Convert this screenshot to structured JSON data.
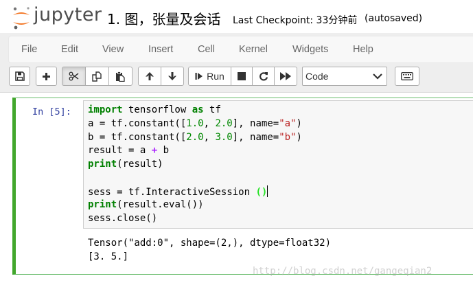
{
  "header": {
    "logo_text": "jupyter",
    "notebook_title": "1. 图，张量及会话",
    "checkpoint": "Last Checkpoint: 33分钟前",
    "autosave_status": "(autosaved)"
  },
  "menu": {
    "items": [
      "File",
      "Edit",
      "View",
      "Insert",
      "Cell",
      "Kernel",
      "Widgets",
      "Help"
    ]
  },
  "toolbar": {
    "run_label": "Run",
    "cell_type": "Code",
    "icons": [
      "save-icon",
      "plus-icon",
      "scissors-icon",
      "copy-icon",
      "paste-icon",
      "arrow-up-icon",
      "arrow-down-icon",
      "step-forward-icon",
      "stop-icon",
      "restart-icon",
      "fast-forward-icon",
      "keyboard-icon"
    ]
  },
  "cell": {
    "prompt": "In [5]:",
    "code": {
      "l1": {
        "kw": "import",
        "a": " tensorflow ",
        "kw2": "as",
        "b": " tf"
      },
      "l2": {
        "a": "a = tf.constant([",
        "n1": "1.0",
        "c": ", ",
        "n2": "2.0",
        "d": "], name=",
        "s": "\"a\"",
        "e": ")"
      },
      "l3": {
        "a": "b = tf.constant([",
        "n1": "2.0",
        "c": ", ",
        "n2": "3.0",
        "d": "], name=",
        "s": "\"b\"",
        "e": ")"
      },
      "l4": {
        "a": "result = a ",
        "op": "+",
        "b": " b"
      },
      "l5": {
        "kw": "print",
        "a": "(result)"
      },
      "l6": {
        "a": "sess = tf.InteractiveSession ",
        "paren": "()"
      },
      "l7": {
        "kw": "print",
        "a": "(result.eval())"
      },
      "l8": {
        "a": "sess.close()"
      }
    },
    "output": [
      "Tensor(\"add:0\", shape=(2,), dtype=float32)",
      "[3. 5.]"
    ]
  },
  "watermark": "http://blog.csdn.net/gangeqian2",
  "colors": {
    "cell_border": "#42a72c",
    "prompt": "#303f9f",
    "keyword": "#008000",
    "number": "#008800",
    "string": "#ba2121",
    "operator": "#aa22ff",
    "logo_orange": "#f37726"
  }
}
